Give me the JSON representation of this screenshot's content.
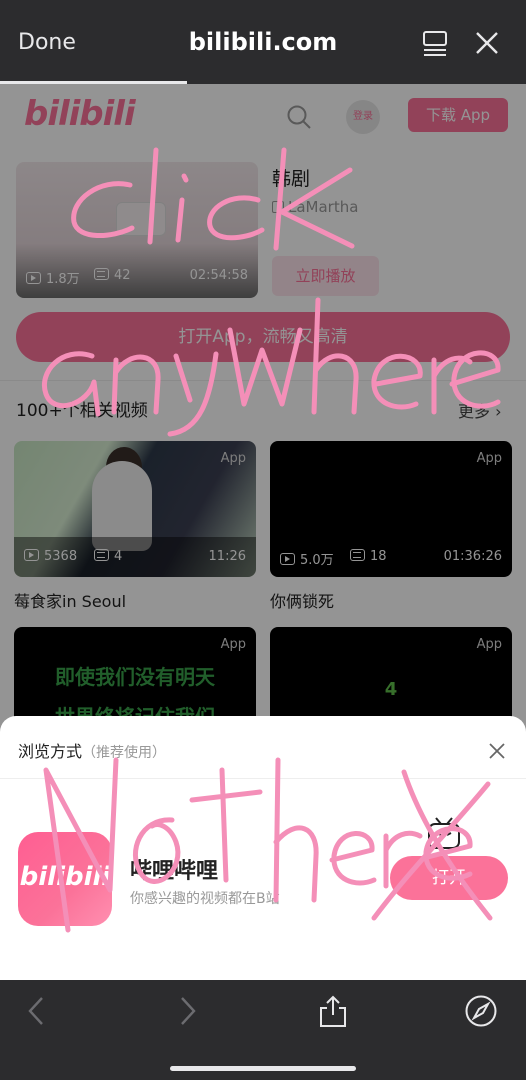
{
  "browser": {
    "done_label": "Done",
    "host": "bilibili.com"
  },
  "header": {
    "logo": "bilibili",
    "login_label": "登录",
    "download_label": "下载 App"
  },
  "hero": {
    "title": "韩剧",
    "author": "LaMartha",
    "views": "1.8万",
    "danmaku": "42",
    "duration": "02:54:58",
    "play_label": "立即播放"
  },
  "open_app_label": "打开App，流畅又高清",
  "related": {
    "title": "100+个相关视频",
    "more_label": "更多",
    "items": [
      {
        "title": "莓食家in Seoul",
        "views": "5368",
        "danmaku": "4",
        "duration": "11:26",
        "tag": "App"
      },
      {
        "title": "你俩锁死",
        "views": "5.0万",
        "danmaku": "18",
        "duration": "01:36:26",
        "tag": "App"
      },
      {
        "tag": "App",
        "poem_line1": "即使我们没有明天",
        "poem_line2": "世界终将记住我们"
      },
      {
        "tag": "App",
        "number": "4"
      }
    ]
  },
  "sheet": {
    "title": "浏览方式",
    "hint": "（推荐使用）",
    "app_icon_text": "bilibili",
    "app_name": "哔哩哔哩",
    "app_desc": "你感兴趣的视频都在B站",
    "open_label": "打开"
  },
  "annotations": {
    "line1": "click",
    "line2": "anywhere",
    "line3": "Not here"
  },
  "colors": {
    "brand": "#fb7299",
    "scribble": "#f48fb8"
  }
}
